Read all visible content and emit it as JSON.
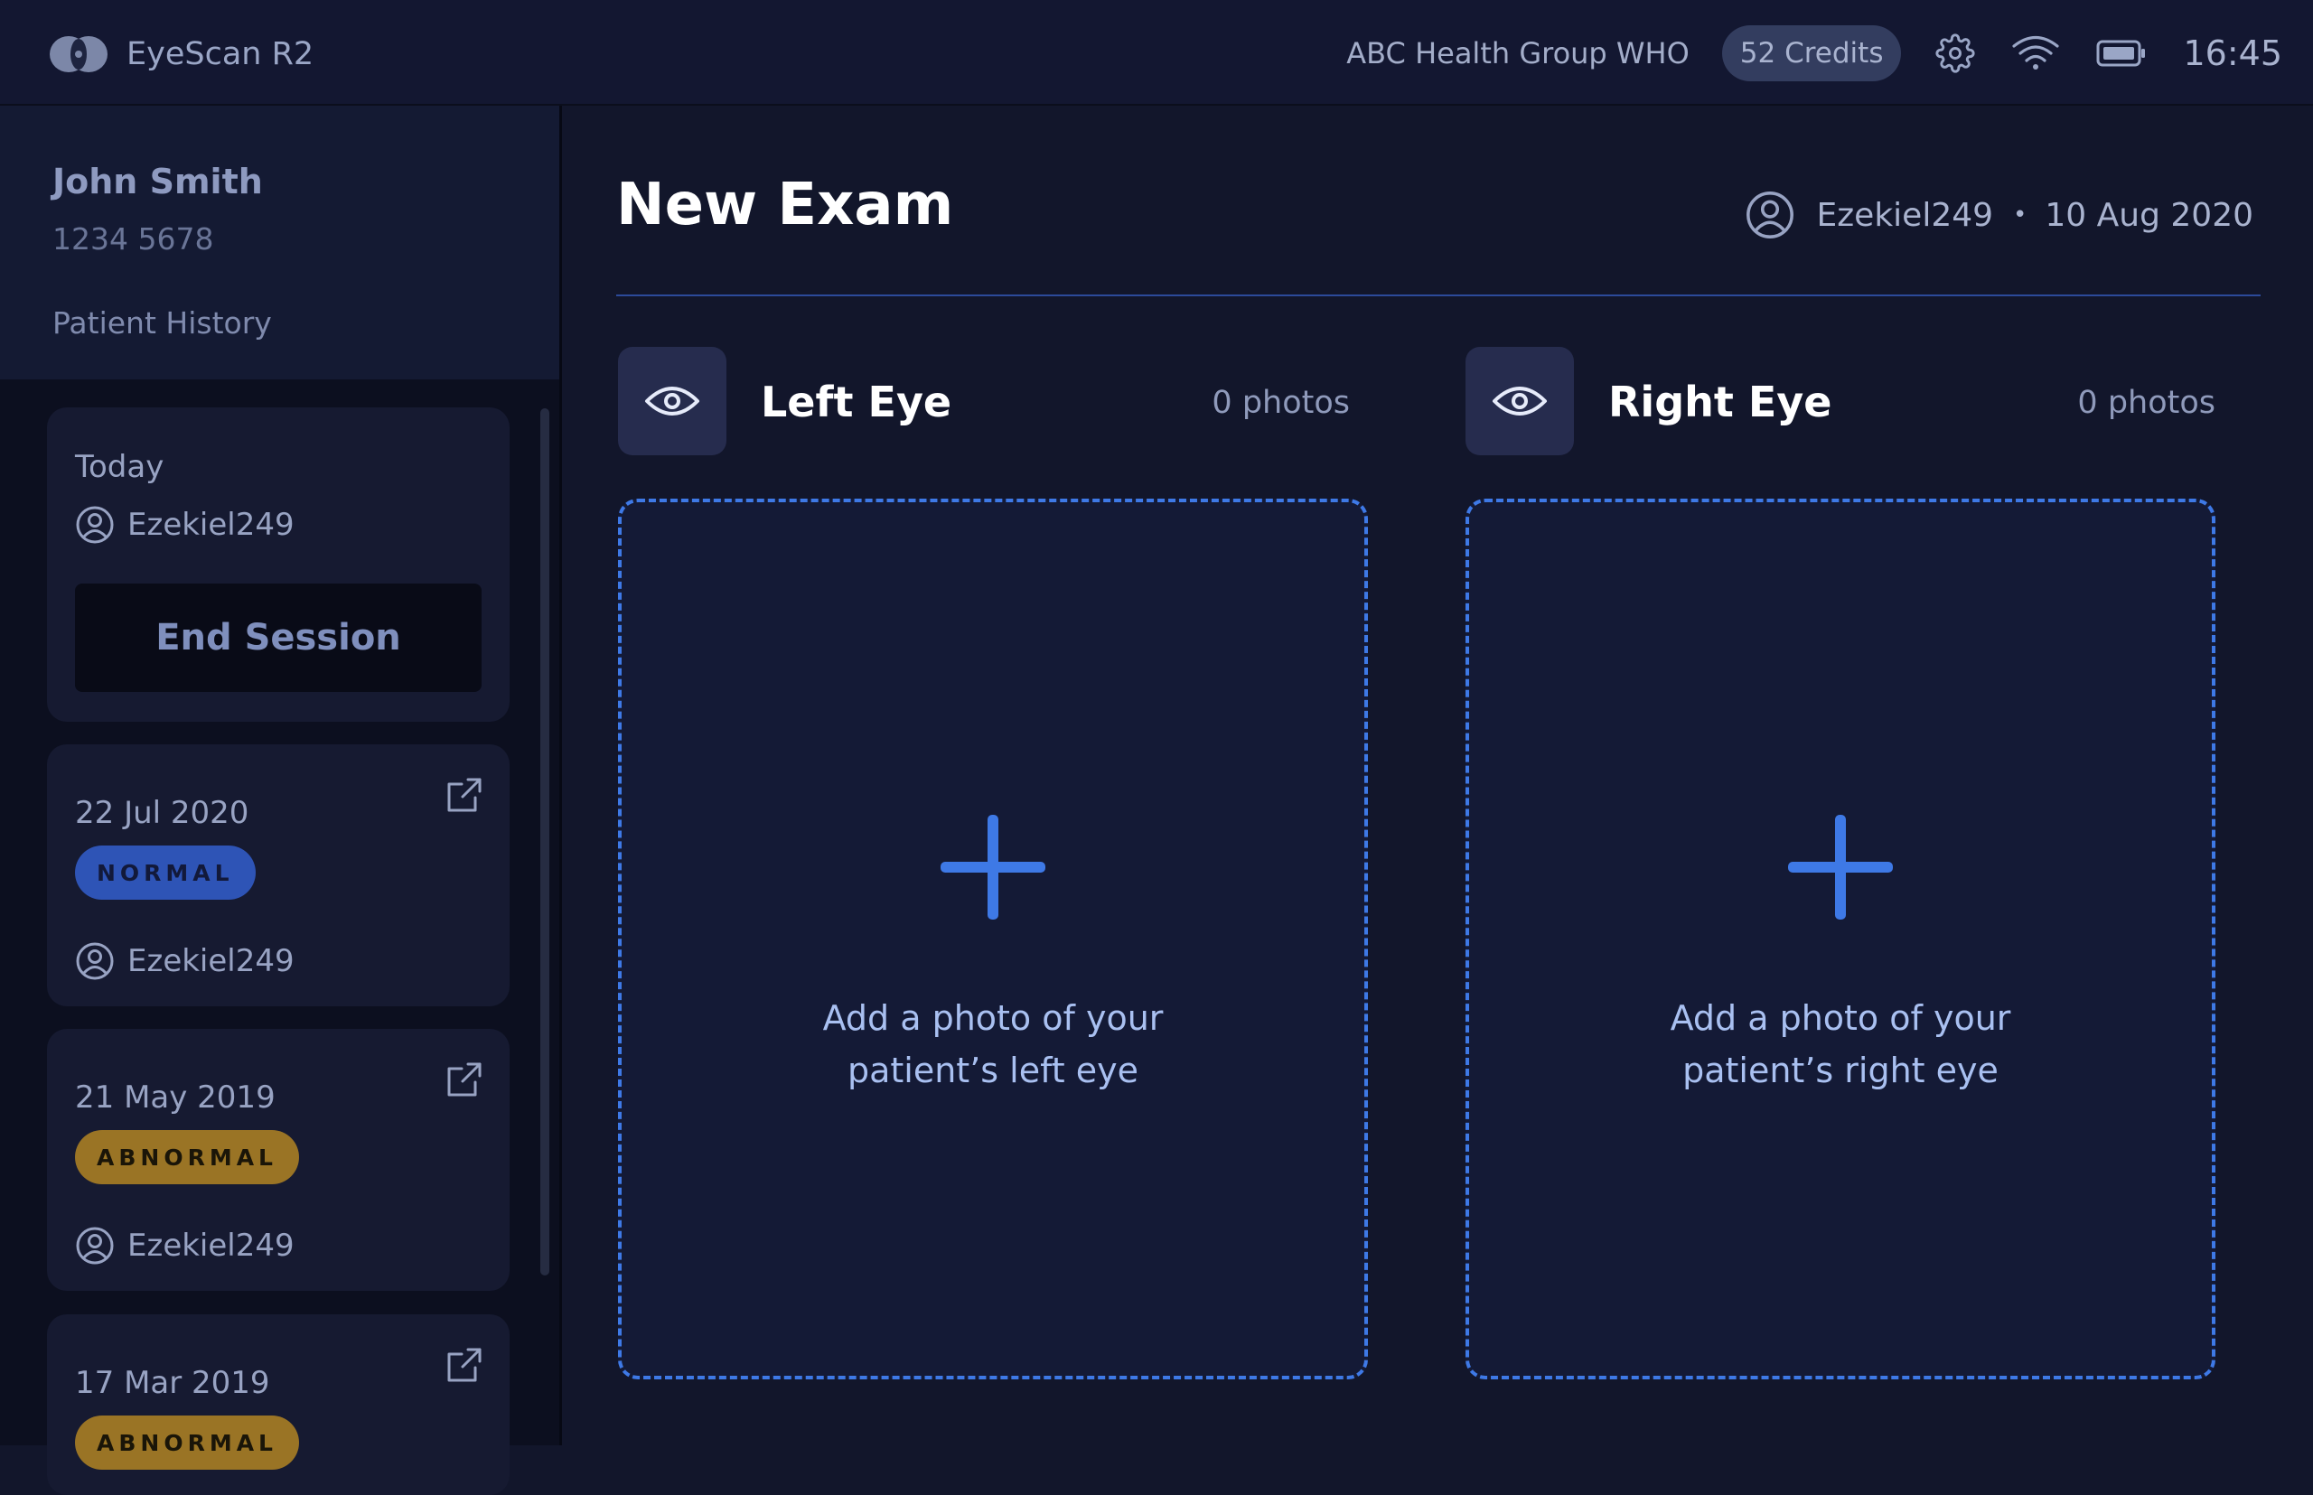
{
  "app": {
    "name": "EyeScan R2",
    "org": "ABC Health Group WHO",
    "credits": "52 Credits",
    "time": "16:45",
    "icons": [
      "settings-icon",
      "wifi-icon",
      "battery-icon"
    ]
  },
  "patient": {
    "name": "John Smith",
    "id": "1234 5678",
    "history_label": "Patient History"
  },
  "sessions": [
    {
      "date": "Today",
      "user": "Ezekiel249",
      "action": "End Session"
    },
    {
      "date": "22 Jul 2020",
      "status": "NORMAL",
      "user": "Ezekiel249"
    },
    {
      "date": "21 May 2019",
      "status": "ABNORMAL",
      "user": "Ezekiel249"
    },
    {
      "date": "17 Mar 2019",
      "status": "ABNORMAL",
      "user": ""
    }
  ],
  "exam": {
    "title": "New Exam",
    "user": "Ezekiel249",
    "separator": "•",
    "date": "10 Aug 2020"
  },
  "eyes": {
    "left": {
      "title": "Left Eye",
      "count": "0 photos",
      "prompt_line1": "Add a photo of your",
      "prompt_line2": "patient’s left eye"
    },
    "right": {
      "title": "Right Eye",
      "count": "0 photos",
      "prompt_line1": "Add a photo of your",
      "prompt_line2": "patient’s right eye"
    }
  },
  "colors": {
    "accent": "#3e79e6",
    "normal": "#2e54b6",
    "abnormal": "#9a7425",
    "background": "#12162b"
  }
}
